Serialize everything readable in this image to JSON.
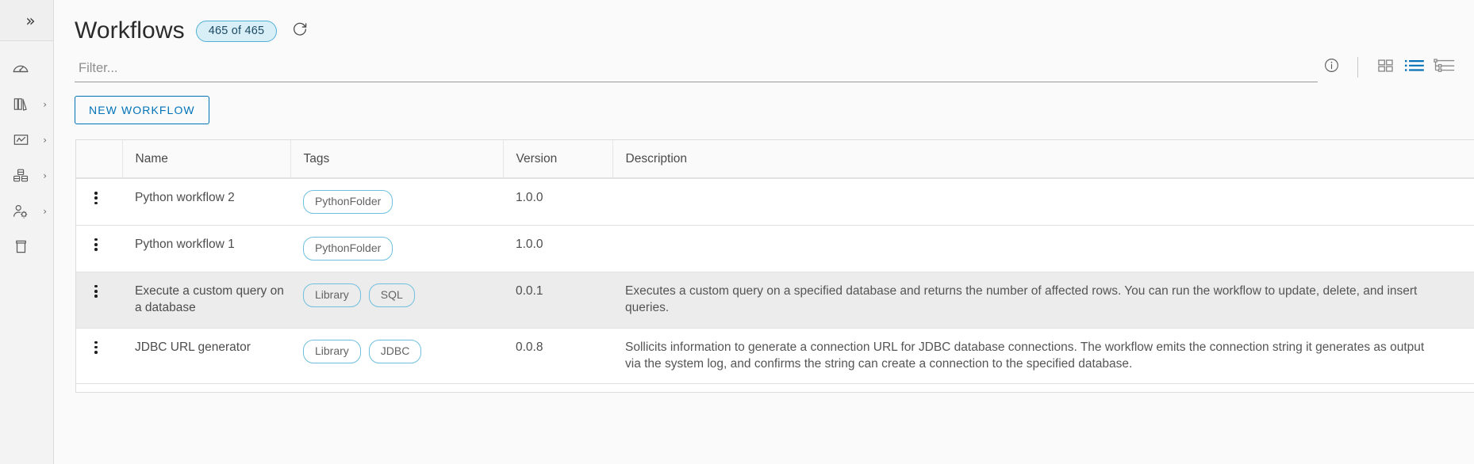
{
  "sidebar": {
    "expand_label": "»",
    "items": [
      {
        "icon": "gauge-icon",
        "name": "dashboard",
        "caret": ""
      },
      {
        "icon": "library-icon",
        "name": "library",
        "caret": "›"
      },
      {
        "icon": "chart-icon",
        "name": "analytics",
        "caret": "›"
      },
      {
        "icon": "packages-icon",
        "name": "packages",
        "caret": "›"
      },
      {
        "icon": "user-settings-icon",
        "name": "user-settings",
        "caret": "›"
      },
      {
        "icon": "archive-icon",
        "name": "archive",
        "caret": ""
      }
    ]
  },
  "header": {
    "title": "Workflows",
    "count_badge": "465 of 465",
    "refresh_tooltip": "Refresh"
  },
  "filter": {
    "placeholder": "Filter...",
    "value": ""
  },
  "toolbar": {
    "info_icon": "info-icon",
    "views": [
      {
        "name": "card-view",
        "icon": "grid-icon",
        "active": false
      },
      {
        "name": "list-view",
        "icon": "list-icon",
        "active": true
      },
      {
        "name": "tree-view",
        "icon": "tree-icon",
        "active": false
      }
    ]
  },
  "actions": {
    "new_workflow_label": "NEW WORKFLOW"
  },
  "table": {
    "columns": [
      "",
      "Name",
      "Tags",
      "Version",
      "Description"
    ],
    "rows": [
      {
        "name": "Python workflow 2",
        "tags": [
          "PythonFolder"
        ],
        "version": "1.0.0",
        "description": "",
        "selected": false
      },
      {
        "name": "Python workflow 1",
        "tags": [
          "PythonFolder"
        ],
        "version": "1.0.0",
        "description": "",
        "selected": false
      },
      {
        "name": "Execute a custom query on a database",
        "tags": [
          "Library",
          "SQL"
        ],
        "version": "0.0.1",
        "description": "Executes a custom query on a specified database and returns the number of affected rows. You can run the workflow to update, delete, and insert queries.",
        "selected": true
      },
      {
        "name": "JDBC URL generator",
        "tags": [
          "Library",
          "JDBC"
        ],
        "version": "0.0.8",
        "description": "Sollicits information to generate a connection URL for JDBC database connections. The workflow emits the connection string it generates as output via the system log, and confirms the string can create a connection to the specified database.",
        "selected": false
      }
    ]
  },
  "colors": {
    "accent_blue": "#0073b7",
    "badge_border": "#51b0d6",
    "badge_fill": "#d9eff8",
    "tag_border": "#6fc0de",
    "row_selected": "#ececec"
  }
}
